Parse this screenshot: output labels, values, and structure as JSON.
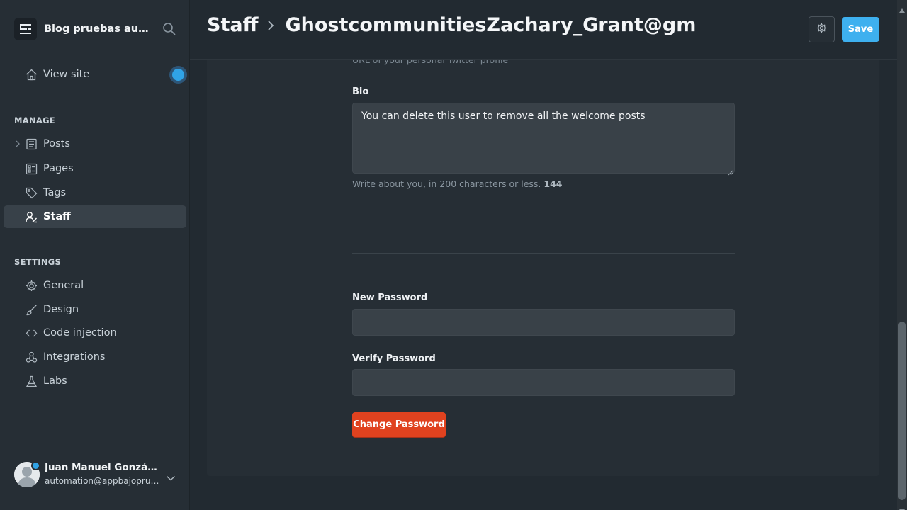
{
  "sidebar": {
    "brand_title": "Blog pruebas automatizadas",
    "view_site": "View site",
    "manage_label": "MANAGE",
    "manage_items": [
      {
        "label": "Posts",
        "icon": "posts-icon"
      },
      {
        "label": "Pages",
        "icon": "pages-icon"
      },
      {
        "label": "Tags",
        "icon": "tag-icon"
      },
      {
        "label": "Staff",
        "icon": "staff-icon",
        "active": true
      }
    ],
    "settings_label": "SETTINGS",
    "settings_items": [
      {
        "label": "General",
        "icon": "gear-icon"
      },
      {
        "label": "Design",
        "icon": "brush-icon"
      },
      {
        "label": "Code injection",
        "icon": "code-icon"
      },
      {
        "label": "Integrations",
        "icon": "integrations-icon"
      },
      {
        "label": "Labs",
        "icon": "flask-icon"
      }
    ],
    "user": {
      "name": "Juan Manuel González",
      "email": "automation@appbajopruebas.com"
    }
  },
  "header": {
    "breadcrumb_root": "Staff",
    "breadcrumb_current": "GhostcommunitiesZachary_Grant@gm",
    "save_label": "Save"
  },
  "form": {
    "cut_hint": "URL of your personal Twitter profile",
    "bio_label": "Bio",
    "bio_value": "You can delete this user to remove all the welcome posts",
    "bio_help": "Write about you, in 200 characters or less.",
    "bio_count": "144",
    "new_password_label": "New Password",
    "new_password_value": "",
    "verify_password_label": "Verify Password",
    "verify_password_value": "",
    "change_password_label": "Change Password"
  },
  "colors": {
    "accent": "#3eb0ef",
    "danger": "#e0421f",
    "background": "#222a31",
    "sidebar": "#262e35"
  }
}
